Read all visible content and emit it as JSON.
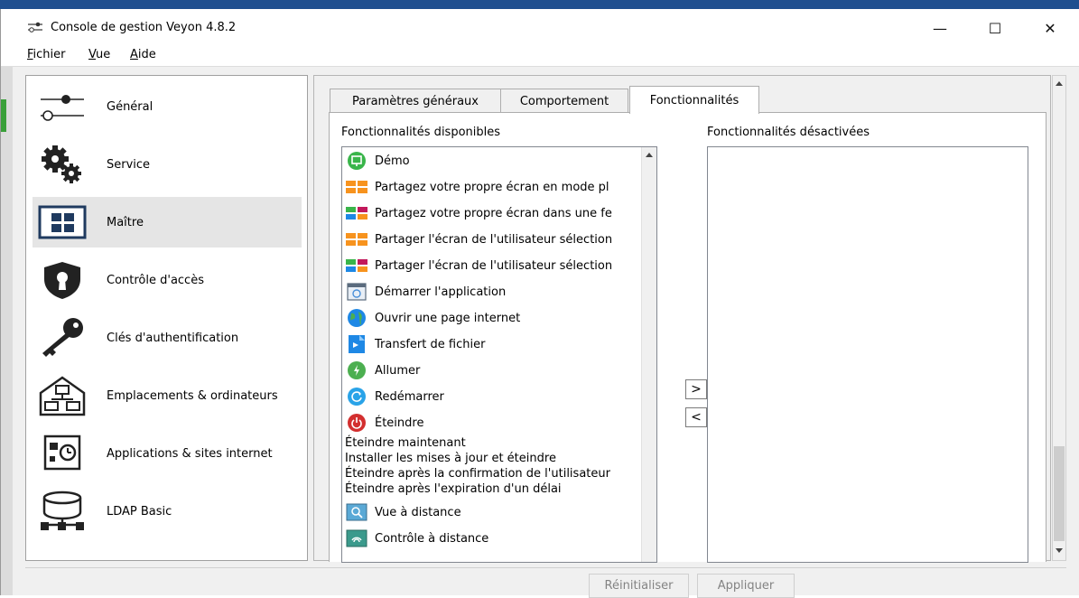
{
  "window": {
    "title": "Console de gestion Veyon 4.8.2"
  },
  "window_controls": {
    "minimize": "—",
    "maximize": "☐",
    "close": "✕"
  },
  "menu": [
    {
      "accel": "F",
      "rest": "ichier"
    },
    {
      "accel": "V",
      "rest": "ue"
    },
    {
      "accel": "A",
      "rest": "ide"
    }
  ],
  "sidebar": {
    "items": [
      {
        "label": "Général",
        "icon": "slider-toggle-icon"
      },
      {
        "label": "Service",
        "icon": "gears-icon"
      },
      {
        "label": "Maître",
        "icon": "master-grid-icon",
        "selected": true
      },
      {
        "label": "Contrôle d'accès",
        "icon": "shield-keyhole-icon"
      },
      {
        "label": "Clés d'authentification",
        "icon": "key-icon"
      },
      {
        "label": "Emplacements & ordinateurs",
        "icon": "house-network-icon"
      },
      {
        "label": "Applications & sites internet",
        "icon": "app-clock-icon"
      },
      {
        "label": "LDAP Basic",
        "icon": "database-network-icon"
      }
    ]
  },
  "tabs": {
    "items": [
      "Paramètres généraux",
      "Comportement",
      "Fonctionnalités"
    ],
    "active": "Fonctionnalités"
  },
  "features": {
    "available_label": "Fonctionnalités disponibles",
    "disabled_label": "Fonctionnalités désactivées",
    "available": [
      {
        "label": "Démo",
        "icon": "demo-screen-icon"
      },
      {
        "label": "Partagez votre propre écran en mode pl",
        "icon": "screen-share-fullscreen-icon"
      },
      {
        "label": "Partagez votre propre écran dans une fe",
        "icon": "screen-share-window-icon"
      },
      {
        "label": "Partager l'écran de l'utilisateur sélection",
        "icon": "screen-share-fullscreen-icon"
      },
      {
        "label": "Partager l'écran de l'utilisateur sélection",
        "icon": "screen-share-window-icon"
      },
      {
        "label": "Démarrer l'application",
        "icon": "start-app-icon"
      },
      {
        "label": "Ouvrir une page internet",
        "icon": "globe-icon"
      },
      {
        "label": "Transfert de fichier",
        "icon": "file-transfer-icon"
      },
      {
        "label": "Allumer",
        "icon": "power-on-icon"
      },
      {
        "label": "Redémarrer",
        "icon": "restart-icon"
      },
      {
        "label": "Éteindre",
        "icon": "power-off-icon"
      }
    ],
    "available_text_only": [
      "Éteindre maintenant",
      "Installer les mises à jour et éteindre",
      "Éteindre après la confirmation de l'utilisateur",
      "Éteindre après l'expiration d'un délai"
    ],
    "available_more": [
      {
        "label": "Vue à distance",
        "icon": "remote-view-icon"
      },
      {
        "label": "Contrôle à distance",
        "icon": "remote-control-icon"
      }
    ],
    "disabled": []
  },
  "move_buttons": {
    "to_disabled": ">",
    "to_available": "<"
  },
  "footer": {
    "reset_label": "Réinitialiser",
    "apply_label": "Appliquer"
  },
  "colors": {
    "accent": "#1f4f8f",
    "selected_bg": "#e5e5e5",
    "disabled_text": "#838383"
  }
}
